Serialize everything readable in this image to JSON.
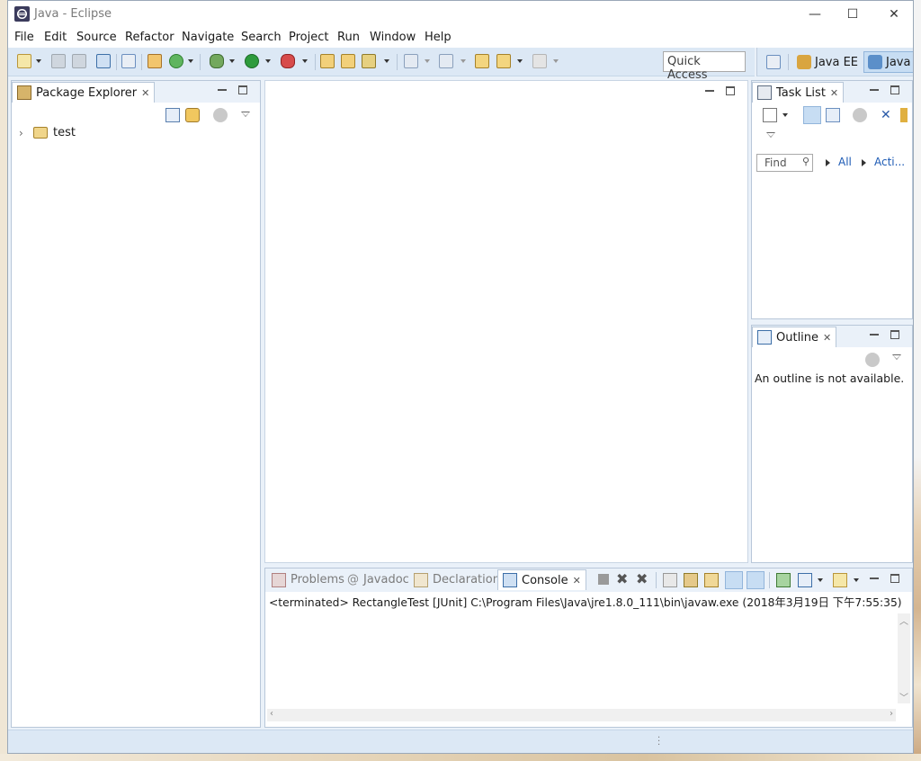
{
  "window": {
    "title": "Java - Eclipse",
    "controls": {
      "minimize": "—",
      "maximize": "☐",
      "close": "✕"
    }
  },
  "menu": [
    "File",
    "Edit",
    "Source",
    "Refactor",
    "Navigate",
    "Search",
    "Project",
    "Run",
    "Window",
    "Help"
  ],
  "toolbar": {
    "quick_access": "Quick Access"
  },
  "perspectives": [
    {
      "label": "Java EE",
      "active": false
    },
    {
      "label": "Java",
      "active": true
    }
  ],
  "package_explorer": {
    "tab": "Package Explorer",
    "items": [
      {
        "label": "test"
      }
    ]
  },
  "task_list": {
    "tab": "Task List",
    "find_placeholder": "Find",
    "filters": [
      "All",
      "Acti..."
    ]
  },
  "outline": {
    "tab": "Outline",
    "message": "An outline is not available."
  },
  "bottom_tabs": [
    {
      "label": "Problems",
      "active": false
    },
    {
      "label": "Javadoc",
      "active": false
    },
    {
      "label": "Declaration",
      "active": false
    },
    {
      "label": "Console",
      "active": true
    }
  ],
  "console": {
    "status": "<terminated> RectangleTest [JUnit] C:\\Program Files\\Java\\jre1.8.0_111\\bin\\javaw.exe (2018年3月19日 下午7:55:35)"
  },
  "colors": {
    "chrome": "#dce8f5",
    "panel_border": "#b8c7d9",
    "link": "#1c5ab4",
    "active_perspective": "#c7ddf3"
  }
}
